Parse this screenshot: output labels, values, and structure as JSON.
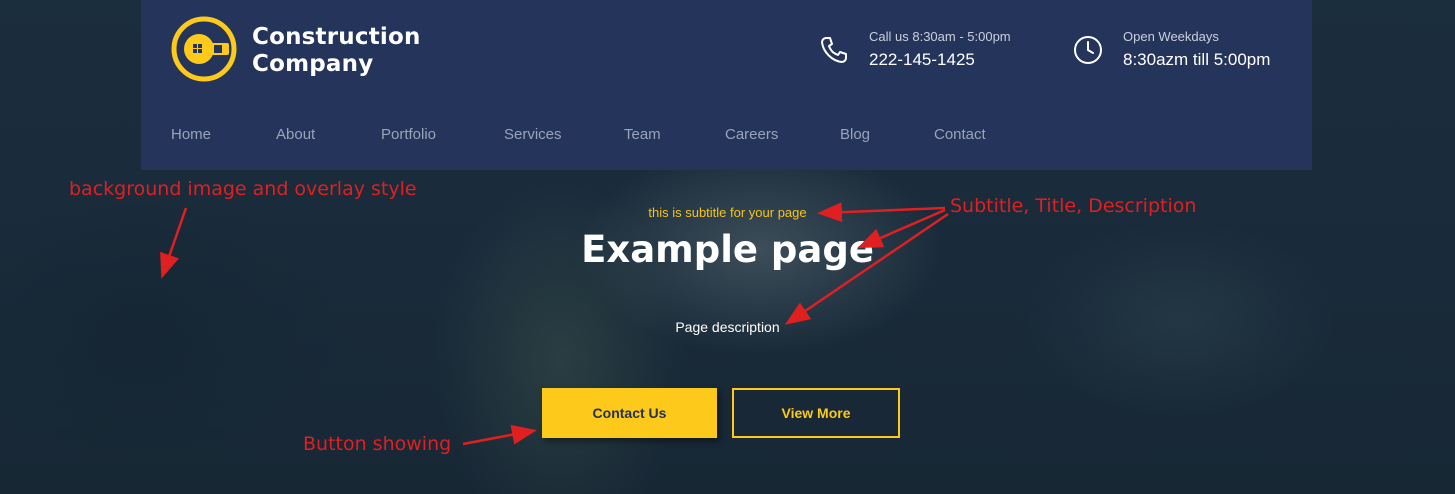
{
  "header": {
    "brand_line1": "Construction",
    "brand_line2": "Company",
    "phone": {
      "label": "Call us 8:30am - 5:00pm",
      "value": "222-145-1425",
      "icon": "phone-icon"
    },
    "hours": {
      "label": "Open Weekdays",
      "value": "8:30azm till 5:00pm",
      "icon": "clock-icon"
    },
    "logo_icon": "wrench-logo-icon"
  },
  "nav": {
    "items": [
      {
        "label": "Home"
      },
      {
        "label": "About"
      },
      {
        "label": "Portfolio"
      },
      {
        "label": "Services"
      },
      {
        "label": "Team"
      },
      {
        "label": "Careers"
      },
      {
        "label": "Blog"
      },
      {
        "label": "Contact"
      }
    ]
  },
  "hero": {
    "subtitle": "this is subtitle for your page",
    "title": "Example page",
    "description": "Page description",
    "primary_button": "Contact Us",
    "secondary_button": "View More"
  },
  "annotations": {
    "background": "background image and overlay style",
    "texts": "Subtitle, Title, Description",
    "buttons": "Button showing"
  },
  "colors": {
    "accent": "#fdc91a",
    "header_bg": "#24345a",
    "annotation": "#e02020"
  }
}
